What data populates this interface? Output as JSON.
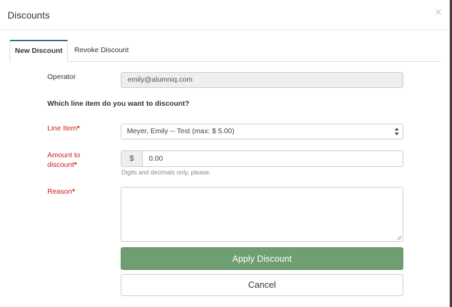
{
  "modal": {
    "title": "Discounts",
    "close_glyph": "×"
  },
  "tabs": [
    {
      "label": "New Discount",
      "active": true
    },
    {
      "label": "Revoke Discount",
      "active": false
    }
  ],
  "form": {
    "operator": {
      "label": "Operator",
      "value": "emily@alumniq.com"
    },
    "question": "Which line item do you want to discount?",
    "line_item": {
      "label": "Line Item",
      "required_mark": "*",
      "selected": "Meyer, Emily -- Test (max: $ 5.00)"
    },
    "amount": {
      "label_line1": "Amount to",
      "label_line2": "discount",
      "required_mark": "*",
      "currency": "$",
      "value": "0.00",
      "help": "Digits and decimals only, please."
    },
    "reason": {
      "label": "Reason",
      "required_mark": "*",
      "value": ""
    }
  },
  "buttons": {
    "apply": "Apply Discount",
    "cancel": "Cancel"
  },
  "colors": {
    "required": "#cc1a1a",
    "apply_bg": "#6f9e72",
    "tab_accent": "#2f6f8f"
  },
  "icons": {
    "close": "close-icon",
    "select": "select-arrows-icon",
    "resize": "resize-handle-icon"
  }
}
